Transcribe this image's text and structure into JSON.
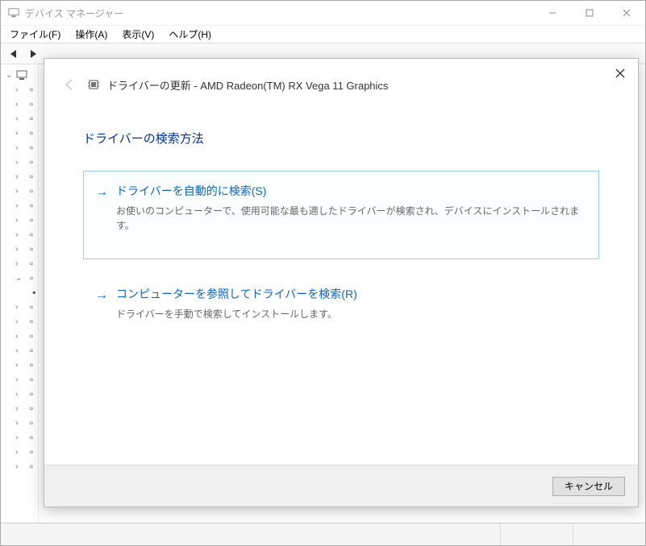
{
  "window": {
    "title": "デバイス マネージャー"
  },
  "menubar": {
    "file": "ファイル(F)",
    "action": "操作(A)",
    "view": "表示(V)",
    "help": "ヘルプ(H)"
  },
  "dialog": {
    "title_prefix": "ドライバーの更新 - ",
    "device": "AMD Radeon(TM) RX Vega 11 Graphics",
    "heading": "ドライバーの検索方法",
    "option_auto": {
      "title": "ドライバーを自動的に検索(S)",
      "desc": "お使いのコンピューターで、使用可能な最も適したドライバーが検索され、デバイスにインストールされます。"
    },
    "option_browse": {
      "title": "コンピューターを参照してドライバーを検索(R)",
      "desc": "ドライバーを手動で検索してインストールします。"
    },
    "cancel": "キャンセル"
  }
}
